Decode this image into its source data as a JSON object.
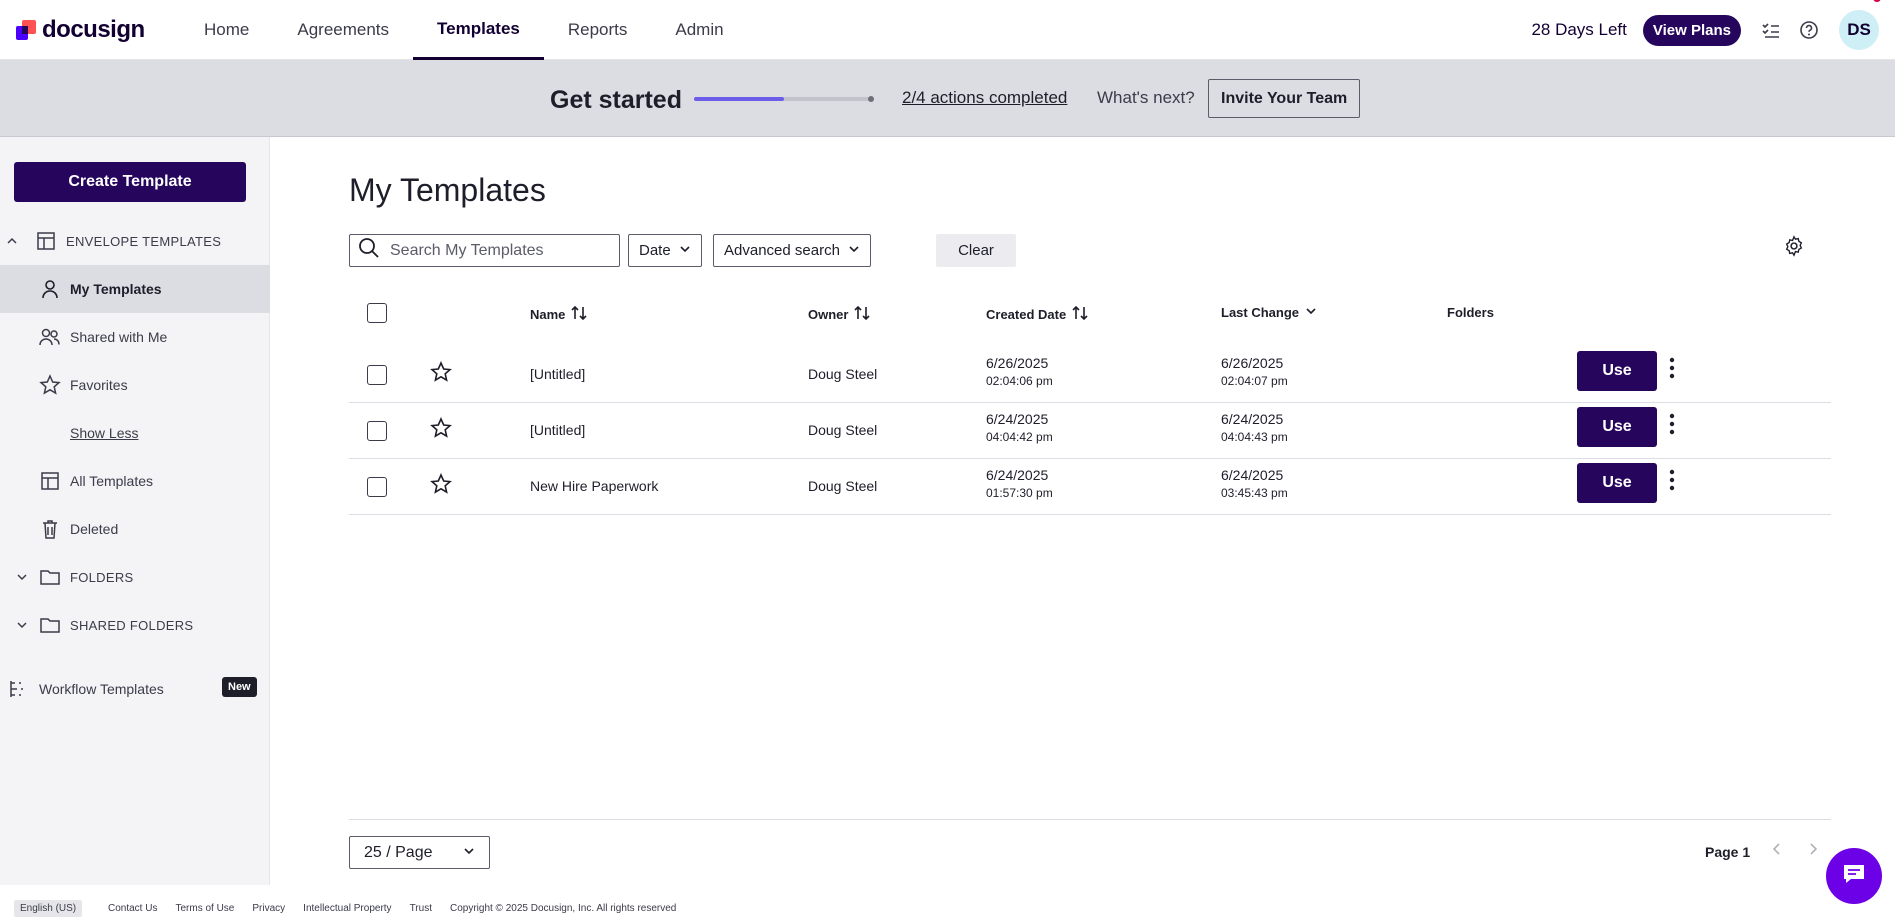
{
  "brand": {
    "logo_text": "docusign"
  },
  "nav": {
    "tabs": [
      {
        "label": "Home",
        "active": false
      },
      {
        "label": "Agreements",
        "active": false
      },
      {
        "label": "Templates",
        "active": true
      },
      {
        "label": "Reports",
        "active": false
      },
      {
        "label": "Admin",
        "active": false
      }
    ],
    "days_left": "28 Days Left",
    "view_plans": "View Plans",
    "avatar_initials": "DS"
  },
  "banner": {
    "title": "Get started",
    "progress_fraction": 0.5,
    "actions_link": "2/4 actions completed",
    "whats_next": "What's next?",
    "invite_button": "Invite Your Team"
  },
  "sidebar": {
    "create_button": "Create Template",
    "envelope_section": "ENVELOPE TEMPLATES",
    "items": [
      {
        "label": "My Templates",
        "icon": "person-icon",
        "selected": true
      },
      {
        "label": "Shared with Me",
        "icon": "people-icon",
        "selected": false
      },
      {
        "label": "Favorites",
        "icon": "star-icon",
        "selected": false
      }
    ],
    "show_less": "Show Less",
    "all_templates": "All Templates",
    "deleted": "Deleted",
    "folders_section": "FOLDERS",
    "shared_folders_section": "SHARED FOLDERS",
    "workflow_templates": "Workflow Templates",
    "new_badge": "New"
  },
  "main": {
    "title": "My Templates",
    "search_placeholder": "Search My Templates",
    "date_filter": "Date",
    "advanced_search": "Advanced search",
    "clear_button": "Clear",
    "columns": {
      "name": "Name",
      "owner": "Owner",
      "created": "Created Date",
      "last_change": "Last Change",
      "folders": "Folders"
    },
    "rows": [
      {
        "name": "[Untitled]",
        "owner": "Doug Steel",
        "created_date": "6/26/2025",
        "created_time": "02:04:06 pm",
        "changed_date": "6/26/2025",
        "changed_time": "02:04:07 pm",
        "use": "Use"
      },
      {
        "name": "[Untitled]",
        "owner": "Doug Steel",
        "created_date": "6/24/2025",
        "created_time": "04:04:42 pm",
        "changed_date": "6/24/2025",
        "changed_time": "04:04:43 pm",
        "use": "Use"
      },
      {
        "name": "New Hire Paperwork",
        "owner": "Doug Steel",
        "created_date": "6/24/2025",
        "created_time": "01:57:30 pm",
        "changed_date": "6/24/2025",
        "changed_time": "03:45:43 pm",
        "use": "Use"
      }
    ],
    "page_size": "25 / Page",
    "page_label": "Page 1"
  },
  "footer": {
    "language": "English (US)",
    "links": [
      "Contact Us",
      "Terms of Use",
      "Privacy",
      "Intellectual Property",
      "Trust",
      "Copyright © 2025 Docusign, Inc. All rights reserved"
    ]
  },
  "colors": {
    "brand_dark": "#26065d",
    "accent": "#6c5ce7",
    "chat": "#6c00e6"
  }
}
